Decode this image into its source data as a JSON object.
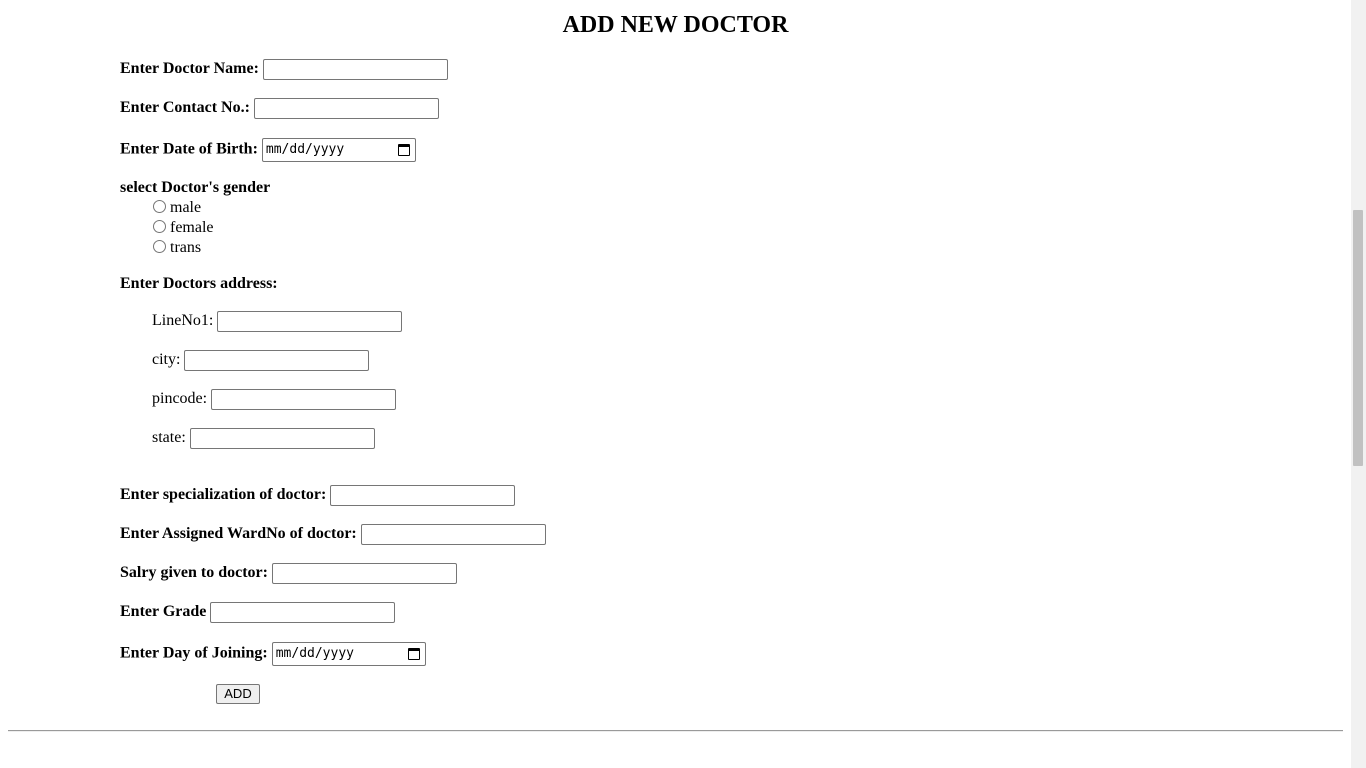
{
  "title": "ADD NEW DOCTOR",
  "fields": {
    "name": {
      "label": "Enter Doctor Name:",
      "value": ""
    },
    "contact": {
      "label": "Enter Contact No.:",
      "value": ""
    },
    "dob": {
      "label": "Enter Date of Birth:",
      "placeholder": "mm/dd/yyyy"
    },
    "gender": {
      "label": "select Doctor's gender",
      "options": [
        "male",
        "female",
        "trans"
      ],
      "selected": null
    },
    "address": {
      "label": "Enter Doctors address:",
      "line1": {
        "label": "LineNo1:",
        "value": ""
      },
      "city": {
        "label": "city:",
        "value": ""
      },
      "pincode": {
        "label": "pincode:",
        "value": ""
      },
      "state": {
        "label": "state:",
        "value": ""
      }
    },
    "specialization": {
      "label": "Enter specialization of doctor:",
      "value": ""
    },
    "ward": {
      "label": "Enter Assigned WardNo of doctor:",
      "value": ""
    },
    "salary": {
      "label": "Salry given to doctor:",
      "value": ""
    },
    "grade": {
      "label": "Enter Grade",
      "value": ""
    },
    "joining": {
      "label": "Enter Day of Joining:",
      "placeholder": "mm/dd/yyyy"
    }
  },
  "submit_label": "ADD",
  "icons": {
    "date_picker": "calendar-icon"
  }
}
